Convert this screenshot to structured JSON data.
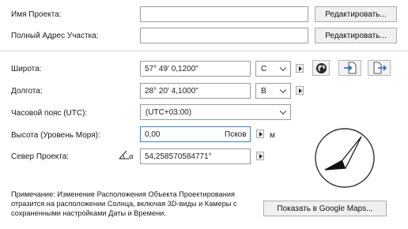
{
  "project_name": {
    "label": "Имя Проекта:",
    "value": "",
    "edit_label": "Редактировать..."
  },
  "site_address": {
    "label": "Полный Адрес Участка:",
    "value": "",
    "edit_label": "Редактировать..."
  },
  "latitude": {
    "label": "Широта:",
    "value": "57° 49' 0,1200\"",
    "hemisphere": "С"
  },
  "longitude": {
    "label": "Долгота:",
    "value": "28° 20' 4,1000\"",
    "hemisphere": "В"
  },
  "timezone": {
    "label": "Часовой пояс (UTC):",
    "value": "(UTC+03:00)"
  },
  "altitude": {
    "label": "Высота (Уровень Моря):",
    "value": "0,00",
    "reference": "Псков",
    "unit": "м"
  },
  "project_north": {
    "label": "Север Проекта:",
    "value": "54,258570584771°"
  },
  "note": {
    "prefix": "Примечание:",
    "line1": " Изменение Расположения Объекта Проектирования",
    "line2": "отразится на расположении Солнца, включая 3D-виды и Камеры с",
    "line3": "сохраненными настройками Даты и Времени."
  },
  "google_maps_button": "Показать в Google Maps...",
  "icons": [
    "globe-icon",
    "import-icon",
    "export-icon",
    "angle-icon",
    "compass-icon"
  ]
}
